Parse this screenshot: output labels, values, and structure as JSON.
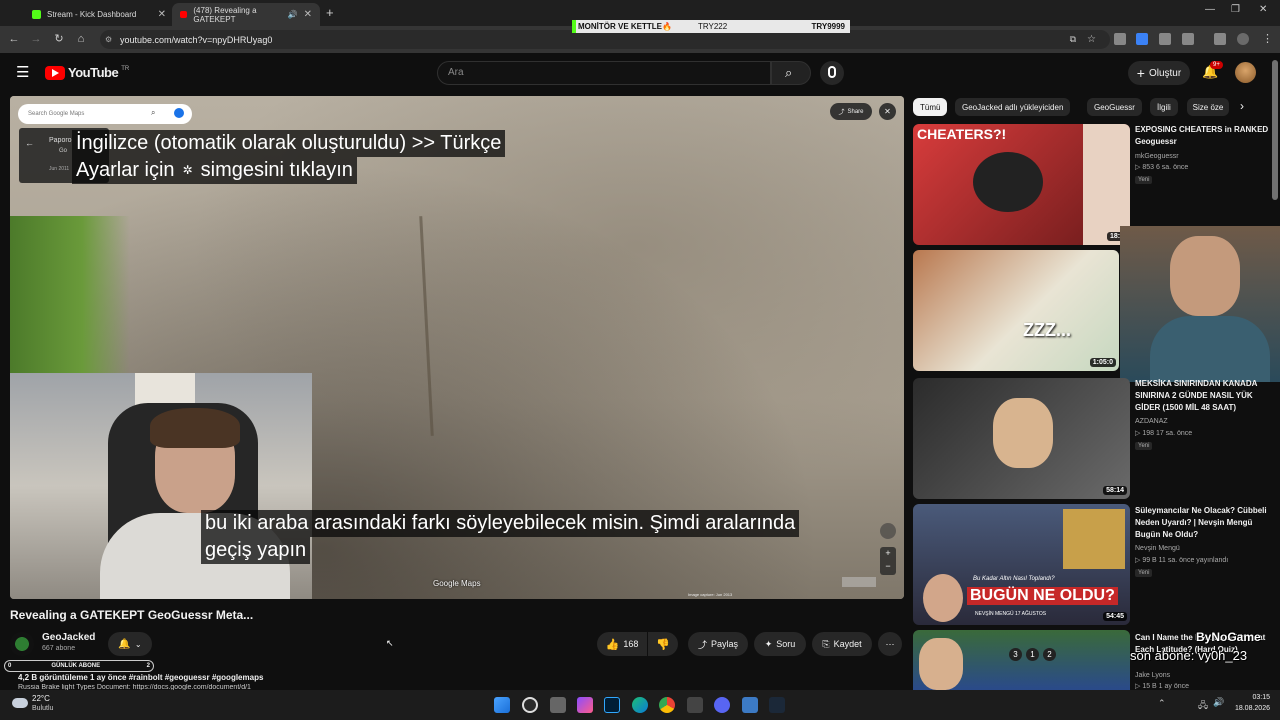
{
  "browser": {
    "tabs": [
      {
        "label": "Stream - Kick Dashboard",
        "active": false
      },
      {
        "label": "(478) Revealing a GATEKEPT",
        "active": true
      }
    ],
    "url": "youtube.com/watch?v=npyDHRUyag0"
  },
  "banner": {
    "label": "MONİTÖR VE KETTLE🔥",
    "code1": "TRY222",
    "code2": "TRY9999"
  },
  "header": {
    "logo": "YouTube",
    "region": "TR",
    "search_placeholder": "Ara",
    "create_label": "Oluştur",
    "notifications": "9+"
  },
  "video": {
    "maps_search_placeholder": "Search Google Maps",
    "share_label": "Share",
    "panel_top": "Paporo",
    "panel_sub": "Go",
    "panel_date": "Jun 2011",
    "subtitle_info_line1": "İngilizce (otomatik olarak oluşturuldu) >> Türkçe",
    "subtitle_info_line2_a": "Ayarlar için",
    "subtitle_info_line2_b": "simgesini tıklayın",
    "caption_line1": "bu iki araba arasındaki farkı söyleyebilecek misin.  Şimdi aralarında",
    "caption_line2": "geçiş yapın",
    "maps_watermark": "Google Maps",
    "image_capture": "Image capture: Jun 2013"
  },
  "meta": {
    "title": "Revealing a GATEKEPT GeoGuessr Meta...",
    "channel": "GeoJacked",
    "subscribers": "667 abone",
    "likes": "168",
    "share": "Paylaş",
    "ask": "Soru",
    "save": "Kaydet",
    "description": "4,2 B görüntüleme  1 ay önce  #rainbolt #geoguessr #googlemaps",
    "desc_link_line": "Russia Brake light Types Document: https://docs.google.com/document/d/1",
    "goal_label": "GÜNLÜK ABONE",
    "goal_left": "0",
    "goal_right": "2"
  },
  "sidebar": {
    "chips": [
      "Tümü",
      "GeoJacked adlı yükleyiciden",
      "GeoGuessr",
      "İlgili",
      "Size öze"
    ],
    "videos": [
      {
        "title": "EXPOSING CHEATERS in RANKED Geoguessr",
        "channel": "mkGeoguessr",
        "stats": "▷ 853  6 sa. önce",
        "badge": "Yeni",
        "duration": "18:3",
        "thumb_text": "CHEATERS?!"
      },
      {
        "title": "",
        "channel": "",
        "stats": "",
        "badge": "",
        "duration": "1:05:0",
        "thumb_text": "ZZZ..."
      },
      {
        "title": "MEKSİKA SINIRINDAN KANADA SINIRINA 2 GÜNDE NASIL YÜK GİDER (1500 MİL 48 SAAT)",
        "channel": "AZDANAZ",
        "stats": "▷ 198  17 sa. önce",
        "badge": "Yeni",
        "duration": "58:14",
        "thumb_text": ""
      },
      {
        "title": "Süleymancılar Ne Olacak? Cübbeli Neden Uyardı? | Nevşin Mengü Bugün Ne Oldu?",
        "channel": "Nevşin Mengü",
        "stats": "▷ 99 B  11 sa. önce yayınlandı",
        "badge": "Yeni",
        "duration": "54:45",
        "thumb_text": "BUGÜN NE OLDU?"
      },
      {
        "title": "Can I Name the European Cities at Each Latitude? (Hard Quiz)",
        "channel": "Jake Lyons",
        "stats": "▷ 15 B  1 ay önce",
        "badge": "",
        "duration": "",
        "thumb_text": ""
      }
    ],
    "thumb_caption_4": "Bu Kadar Altın Nasıl Toplandı?",
    "thumb_caption_4b": "NEVŞİN MENGÜ   17 AĞUSTOS"
  },
  "overlay": {
    "follower_alert": "ByNoGame",
    "follower_alert2": "son abone: vy0h_23"
  },
  "taskbar": {
    "weather_temp": "22°C",
    "weather_desc": "Bulutlu",
    "time": "03:15",
    "date": "18.08.2026"
  },
  "colors": {
    "yt_red": "#ff0000",
    "kick_green": "#53fc18",
    "bg": "#0f0f0f"
  }
}
